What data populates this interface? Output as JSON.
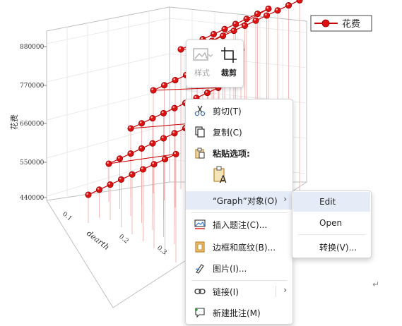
{
  "chart_data": {
    "type": "scatter",
    "title": "",
    "ylabel": "花费",
    "xlabel": "dearth",
    "zlabel": "",
    "y_ticks": [
      "880000",
      "770000",
      "660000",
      "550000",
      "440000"
    ],
    "x_ticks": [
      "0.1",
      "0.2",
      "0.3"
    ],
    "legend": "花费",
    "legend_position": "top-right",
    "grid": true,
    "series_color": "#cc0000",
    "series": [
      {
        "name": "花费",
        "rows": 6,
        "points_per_row": 9
      }
    ]
  },
  "mini_toolbar": {
    "style_label": "样式",
    "crop_label": "裁剪"
  },
  "context_menu": {
    "cut": "剪切(T)",
    "copy": "复制(C)",
    "paste_options": "粘贴选项:",
    "graph_object": "“Graph”对象(O)",
    "insert_caption": "插入题注(C)...",
    "borders_shading": "边框和底纹(B)...",
    "picture": "图片(I)...",
    "link": "链接(I)",
    "new_comment": "新建批注(M)",
    "paste_glyph": "A"
  },
  "submenu": {
    "edit": "Edit",
    "open": "Open",
    "convert": "转换(V)..."
  },
  "paragraph_mark": "↵"
}
